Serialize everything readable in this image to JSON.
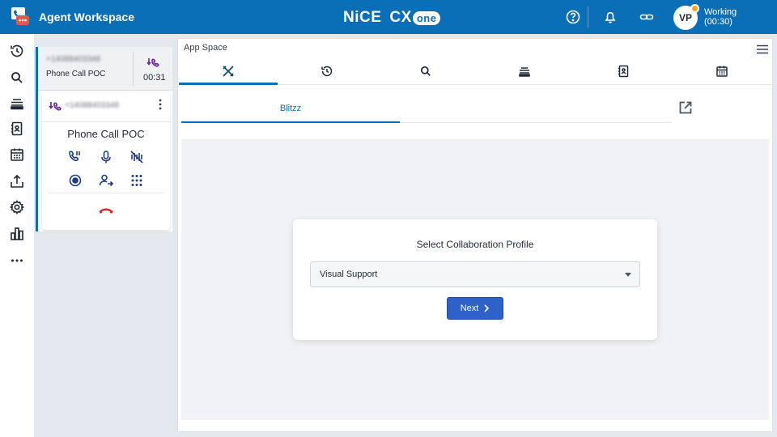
{
  "header": {
    "app_title": "Agent Workspace",
    "brand_main": "NiCE",
    "brand_cx": "CX",
    "brand_one": "one",
    "avatar_initials": "VP",
    "status_label": "Working",
    "status_timer": "(00:30)",
    "icons": [
      "help-icon",
      "bell-icon",
      "link-icon"
    ],
    "status_color": "#f5a623",
    "accent": "#0b6fb8"
  },
  "rail": {
    "icons": [
      "history-icon",
      "search-icon",
      "queue-icon",
      "directory-icon",
      "calendar-icon",
      "upload-icon",
      "settings-icon",
      "reports-icon",
      "more-icon"
    ]
  },
  "contact": {
    "phone_number": "+14088403348",
    "call_label": "Phone Call POC",
    "timer": "00:31",
    "inner_number": "+14088403348",
    "inner_title": "Phone Call POC",
    "controls": [
      "hold-icon",
      "mute-icon",
      "mask-icon",
      "record-icon",
      "transfer-icon",
      "dialpad-icon"
    ],
    "hangup_color": "#dc2626"
  },
  "app_space": {
    "title": "App Space",
    "tabs": [
      "tools-icon",
      "history-icon",
      "search-icon",
      "queue-icon",
      "directory-icon",
      "calendar-icon"
    ],
    "active_tab": 0,
    "sub_tab_label": "Blitzz",
    "dialog": {
      "title": "Select Collaboration Profile",
      "selected_profile": "Visual Support",
      "next_label": "Next"
    }
  }
}
